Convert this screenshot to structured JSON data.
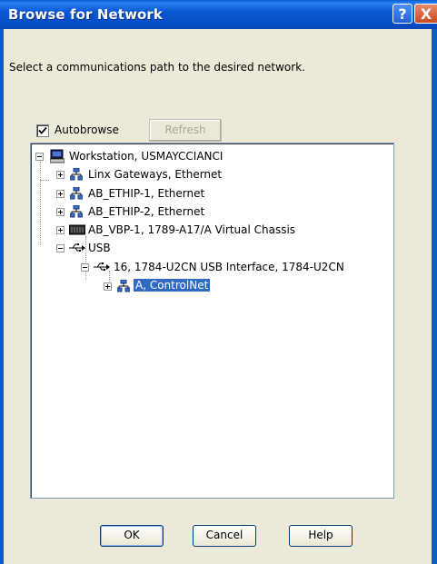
{
  "window": {
    "title": "Browse for Network",
    "help_symbol": "?",
    "close_symbol": "X"
  },
  "prompt": "Select a communications path to the desired network.",
  "autobrowse": {
    "label": "Autobrowse",
    "checked": true
  },
  "refresh_label": "Refresh",
  "tree": {
    "root": "Workstation, USMAYCCIANCI",
    "items": [
      {
        "label": "Linx Gateways, Ethernet",
        "icon": "network-icon"
      },
      {
        "label": "AB_ETHIP-1, Ethernet",
        "icon": "network-icon"
      },
      {
        "label": "AB_ETHIP-2, Ethernet",
        "icon": "network-icon"
      },
      {
        "label": "AB_VBP-1, 1789-A17/A Virtual Chassis",
        "icon": "chassis-icon"
      },
      {
        "label": "USB",
        "icon": "usb-icon"
      }
    ],
    "usb_child": "16, 1784-U2CN USB Interface, 1784-U2CN",
    "selected": "A, ControlNet"
  },
  "buttons": {
    "ok": "OK",
    "cancel": "Cancel",
    "help": "Help"
  }
}
